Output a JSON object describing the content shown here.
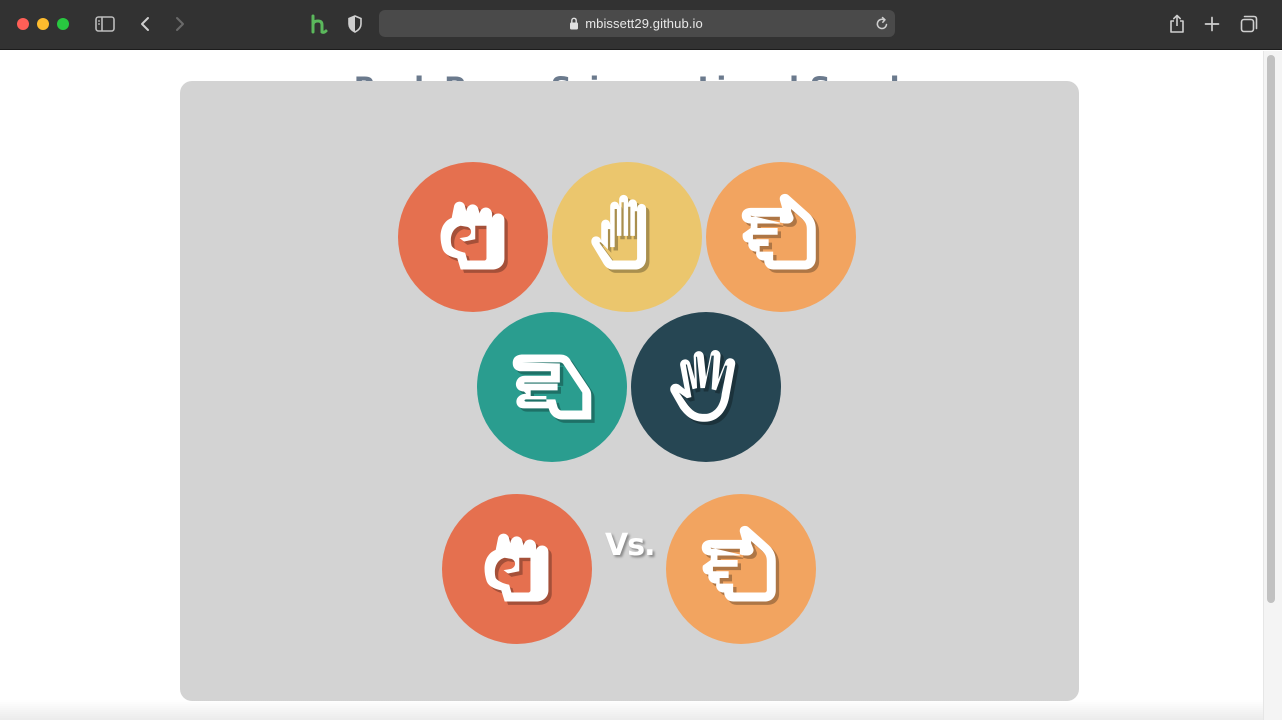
{
  "browser": {
    "url": "mbissett29.github.io"
  },
  "page": {
    "title": "Rock Paper Scissors Lizard Spock",
    "vs_label": "Vs."
  },
  "colors": {
    "rock": "#e5704f",
    "paper": "#ebc66d",
    "scissors": "#f2a460",
    "lizard": "#2a9d8f",
    "spock": "#264653",
    "board": "#d3d3d3",
    "title": "#6b7a8d"
  },
  "choices": [
    {
      "name": "rock",
      "icon": "fist-icon"
    },
    {
      "name": "paper",
      "icon": "open-hand-icon"
    },
    {
      "name": "scissors",
      "icon": "pointing-hand-icon"
    },
    {
      "name": "lizard",
      "icon": "lizard-hand-icon"
    },
    {
      "name": "spock",
      "icon": "vulcan-salute-icon"
    }
  ],
  "matchup": {
    "player": "rock",
    "computer": "scissors"
  }
}
